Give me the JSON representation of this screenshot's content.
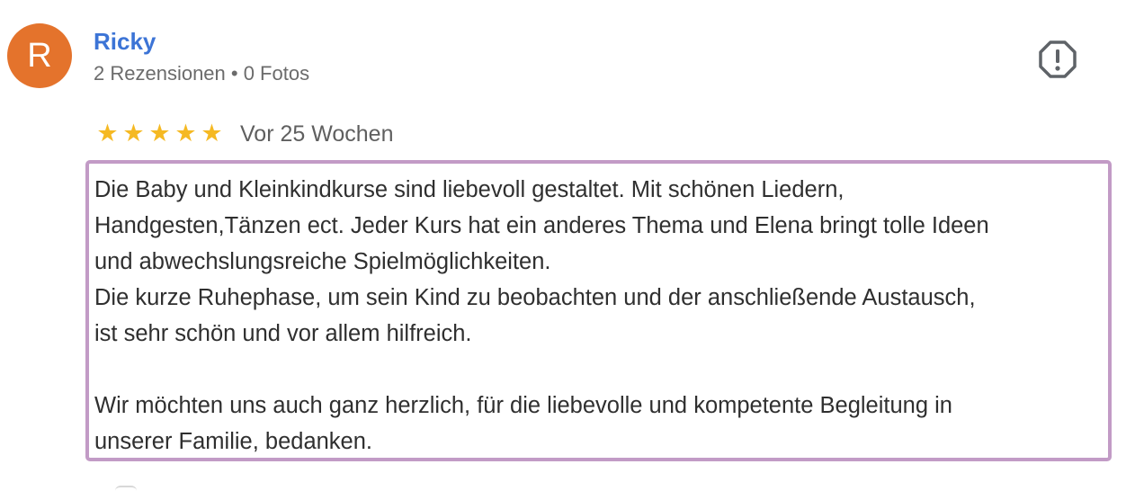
{
  "reviewer": {
    "avatar_letter": "R",
    "avatar_color": "#e4732c",
    "name": "Ricky",
    "meta": "2 Rezensionen • 0 Fotos"
  },
  "rating": {
    "stars": 5,
    "max_stars": 5,
    "star_glyph": "★",
    "time_ago": "Vor 25 Wochen"
  },
  "review_text": {
    "paragraph_1": "Die Baby und Kleinkindkurse sind liebevoll gestaltet. Mit schönen Liedern,\nHandgesten,Tänzen ect. Jeder Kurs hat ein anderes Thema und Elena bringt tolle Ideen\nund abwechslungsreiche Spielmöglichkeiten.\nDie kurze Ruhephase, um sein Kind zu beobachten und der anschließende Austausch,\nist sehr schön und vor allem hilfreich.",
    "paragraph_2": "Wir möchten uns auch ganz herzlich, für die liebevolle und kompetente Begleitung in\nunserer Familie, bedanken."
  },
  "icons": {
    "report": "report-flag-icon"
  },
  "colors": {
    "name_link": "#3c74d6",
    "star": "#f5b923",
    "highlight_border": "#c29bc6"
  }
}
